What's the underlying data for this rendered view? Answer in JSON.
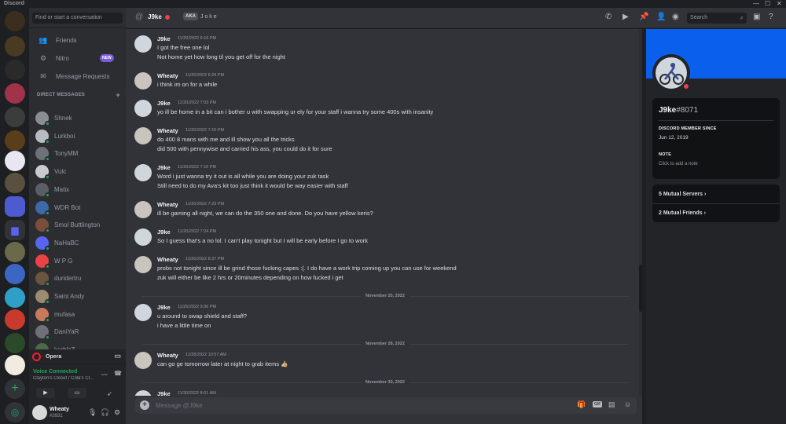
{
  "window": {
    "title": "Discord",
    "controls": [
      "—",
      "☐",
      "✕"
    ]
  },
  "sidebar": {
    "search_placeholder": "Find or start a conversation",
    "nav": [
      {
        "label": "Friends",
        "icon": "friends-icon"
      },
      {
        "label": "Nitro",
        "icon": "nitro-icon",
        "badge": "NEW"
      },
      {
        "label": "Message Requests",
        "icon": "envelope-icon"
      }
    ],
    "dm_header": "DIRECT MESSAGES",
    "dms": [
      {
        "name": "Shnek",
        "color": "#8a8d93"
      },
      {
        "name": "Lurkboi",
        "color": "#b8bcc2"
      },
      {
        "name": "TonyMM",
        "color": "#6e7178"
      },
      {
        "name": "Vulc",
        "color": "#c7cbd0"
      },
      {
        "name": "Matix",
        "color": "#5a5e66"
      },
      {
        "name": "WDR Bot",
        "color": "#3c6aa8"
      },
      {
        "name": "Smol Buttlington",
        "color": "#7a4e3a"
      },
      {
        "name": "NaHaBC",
        "color": "#5865f2"
      },
      {
        "name": "W P G",
        "color": "#ed4245"
      },
      {
        "name": "duridertru",
        "color": "#6b5540"
      },
      {
        "name": "Saint Andy",
        "color": "#9a8b72"
      },
      {
        "name": "mufasa",
        "color": "#c97a5a"
      },
      {
        "name": "DaniYaR",
        "color": "#6e7178"
      },
      {
        "name": "korblzZ",
        "color": "#4a6a4a"
      }
    ],
    "activity": {
      "name": "Opera"
    },
    "voice": {
      "status": "Voice Connected",
      "channel": "Clayton's Closet / Cola's Cl..."
    },
    "user": {
      "name": "Wheaty",
      "tag": "#3931"
    }
  },
  "header": {
    "name": "J9ke",
    "aka_badge": "AKA",
    "aka": "J o k e",
    "search_placeholder": "Search"
  },
  "messages": [
    {
      "author": "J9ke",
      "time": "11/20/2022 6:16 PM",
      "avatar_color": "#cfd6de",
      "lines": [
        "I got the free one lol",
        "Not home yet how long til you get off for the night"
      ]
    },
    {
      "author": "Wheaty",
      "time": "11/20/2022 6:24 PM",
      "avatar_color": "#c9c4bd",
      "lines": [
        "i think im on for a while"
      ]
    },
    {
      "author": "J9ke",
      "time": "11/20/2022 7:03 PM",
      "avatar_color": "#cfd6de",
      "lines": [
        "yo ill be home in a bit can i bother u with swapping ur ely for your staff i wanna try some 400s with insanity"
      ]
    },
    {
      "author": "Wheaty",
      "time": "11/20/2022 7:15 PM",
      "avatar_color": "#c9c4bd",
      "lines": [
        "do 400 8 mans with me and ill show you all the tricks",
        "did 500 with pennywise and carried his ass, you could do it for sure"
      ]
    },
    {
      "author": "J9ke",
      "time": "11/20/2022 7:16 PM",
      "avatar_color": "#cfd6de",
      "lines": [
        "Word i just wanna try it out is all while you are doing your zuk task",
        "Still need to do my Ava's kit too just think it would be way easier with staff"
      ]
    },
    {
      "author": "Wheaty",
      "time": "11/20/2022 7:23 PM",
      "avatar_color": "#c9c4bd",
      "lines": [
        "ill be gaming all night, we can do the 350 one and done. Do you have yellow keris?"
      ]
    },
    {
      "author": "J9ke",
      "time": "11/20/2022 7:24 PM",
      "avatar_color": "#cfd6de",
      "lines": [
        "So I guess that's a no lol. I can't play tonight but I will be early before I go to work"
      ]
    },
    {
      "author": "Wheaty",
      "time": "11/20/2022 8:37 PM",
      "avatar_color": "#c9c4bd",
      "lines": [
        "probs not tonight since ill be grind those fucking capes :(. I do have a work trip coming up you can use for weekend",
        "zuk will either be like 2 hrs or 20minutes depending on how fucked i get"
      ]
    },
    {
      "divider": "November 25, 2022"
    },
    {
      "author": "J9ke",
      "time": "11/25/2022 9:36 PM",
      "avatar_color": "#cfd6de",
      "lines": [
        "u around to swap shield and staff?",
        "i have a little time on"
      ]
    },
    {
      "divider": "November 28, 2022"
    },
    {
      "author": "Wheaty",
      "time": "11/28/2022 10:57 AM",
      "avatar_color": "#c9c4bd",
      "lines": [
        "can go ge tomorrow later at night to grab items 👍🏼"
      ]
    },
    {
      "divider": "November 30, 2022"
    },
    {
      "author": "J9ke",
      "time": "11/30/2022 8:01 AM",
      "avatar_color": "#cfd6de",
      "lines": []
    }
  ],
  "composer": {
    "placeholder": "Message @J9ke"
  },
  "profile": {
    "name": "J9ke",
    "discriminator": "#8071",
    "banner_color": "#0a5fec",
    "member_since_label": "DISCORD MEMBER SINCE",
    "member_since": "Jun 12, 2019",
    "note_label": "NOTE",
    "note_placeholder": "Click to add a note",
    "mutual_servers": "5 Mutual Servers",
    "mutual_friends": "2 Mutual Friends"
  },
  "colors": {
    "online": "#23a55a",
    "dnd": "#f23f43",
    "blurple": "#5865f2"
  }
}
